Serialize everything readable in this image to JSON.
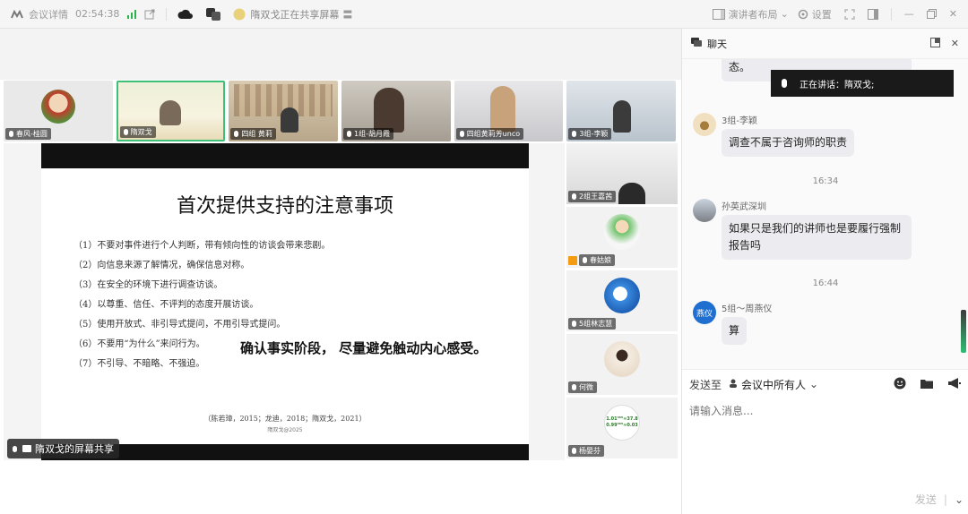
{
  "topbar": {
    "meeting_info": "会议详情",
    "duration": "02:54:38",
    "sharing_status": "隋双戈正在共享屏幕",
    "layout_label": "演讲者布局",
    "settings_label": "设置"
  },
  "participants_top": [
    {
      "name": "春风-桂圆"
    },
    {
      "name": "隋双戈"
    },
    {
      "name": "四组 黄莉"
    },
    {
      "name": "1组-胡月霞"
    },
    {
      "name": "四组黄莉芳unco"
    },
    {
      "name": "3组-李颖"
    }
  ],
  "participants_side": [
    {
      "name": "2组王嘉茜"
    },
    {
      "name": "春姑娘"
    },
    {
      "name": "5组林志慧"
    },
    {
      "name": "何微"
    },
    {
      "name": "杨晏芬"
    }
  ],
  "side_avatar_text": "1.01³⁶⁵≈37.8 0.99³⁶⁵≈0.03",
  "slide": {
    "title": "首次提供支持的注意事项",
    "rules": [
      "（1）不要对事件进行个人判断，带有倾向性的访谈会带来悲剧。",
      "（2）向信息来源了解情况，确保信息对称。",
      "（3）在安全的环境下进行调查访谈。",
      "（4）以尊重、信任、不评判的态度开展访谈。",
      "（5）使用开放式、非引导式提问，不用引导式提问。",
      "（6）不要用“为什么”来问行为。",
      "（7）不引导、不暗略、不强迫。"
    ],
    "callout": "确认事实阶段， 尽量避免触动内心感受。",
    "citation": "（陈若璋，2015；龙迪，2018；隋双戈，2021）",
    "watermark": "隋双戈@2025"
  },
  "share_tag": "隋双戈的屏幕共享",
  "chat": {
    "title": "聊天",
    "toast": "正在讲话：隋双戈;",
    "partial_msg": "态。",
    "messages": [
      {
        "sender": "3组-李颖",
        "text": "调查不属于咨询师的职责",
        "avatar_color": "#d9b36c"
      },
      {
        "time": "16:34"
      },
      {
        "sender": "孙英武深圳",
        "text": "如果只是我们的讲师也是要履行强制报告吗",
        "avatar_color": "#8a8f9a"
      },
      {
        "time": "16:44"
      },
      {
        "sender": "5组～周燕仪",
        "text": "算",
        "avatar_color": "#1f6fd1",
        "avatar_text": "燕仪"
      }
    ],
    "send_to_label": "发送至",
    "send_to_value": "会议中所有人",
    "input_placeholder": "请输入消息...",
    "send_button": "发送"
  }
}
